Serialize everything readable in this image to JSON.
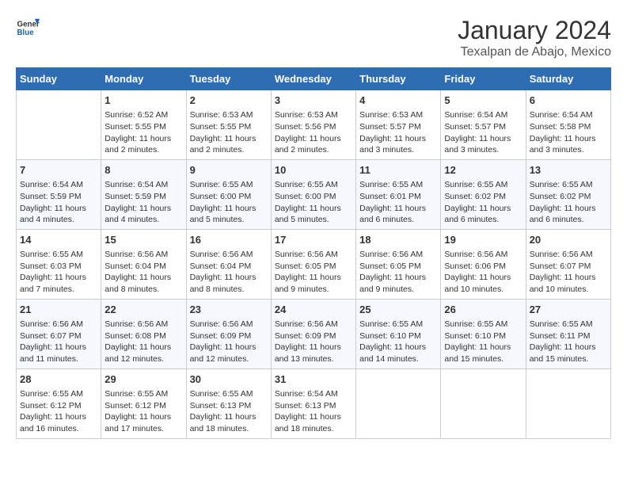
{
  "logo": {
    "line1": "General",
    "line2": "Blue"
  },
  "title": "January 2024",
  "location": "Texalpan de Abajo, Mexico",
  "days_of_week": [
    "Sunday",
    "Monday",
    "Tuesday",
    "Wednesday",
    "Thursday",
    "Friday",
    "Saturday"
  ],
  "weeks": [
    [
      {
        "day": "",
        "sunrise": "",
        "sunset": "",
        "daylight": ""
      },
      {
        "day": "1",
        "sunrise": "Sunrise: 6:52 AM",
        "sunset": "Sunset: 5:55 PM",
        "daylight": "Daylight: 11 hours and 2 minutes."
      },
      {
        "day": "2",
        "sunrise": "Sunrise: 6:53 AM",
        "sunset": "Sunset: 5:55 PM",
        "daylight": "Daylight: 11 hours and 2 minutes."
      },
      {
        "day": "3",
        "sunrise": "Sunrise: 6:53 AM",
        "sunset": "Sunset: 5:56 PM",
        "daylight": "Daylight: 11 hours and 2 minutes."
      },
      {
        "day": "4",
        "sunrise": "Sunrise: 6:53 AM",
        "sunset": "Sunset: 5:57 PM",
        "daylight": "Daylight: 11 hours and 3 minutes."
      },
      {
        "day": "5",
        "sunrise": "Sunrise: 6:54 AM",
        "sunset": "Sunset: 5:57 PM",
        "daylight": "Daylight: 11 hours and 3 minutes."
      },
      {
        "day": "6",
        "sunrise": "Sunrise: 6:54 AM",
        "sunset": "Sunset: 5:58 PM",
        "daylight": "Daylight: 11 hours and 3 minutes."
      }
    ],
    [
      {
        "day": "7",
        "sunrise": "Sunrise: 6:54 AM",
        "sunset": "Sunset: 5:59 PM",
        "daylight": "Daylight: 11 hours and 4 minutes."
      },
      {
        "day": "8",
        "sunrise": "Sunrise: 6:54 AM",
        "sunset": "Sunset: 5:59 PM",
        "daylight": "Daylight: 11 hours and 4 minutes."
      },
      {
        "day": "9",
        "sunrise": "Sunrise: 6:55 AM",
        "sunset": "Sunset: 6:00 PM",
        "daylight": "Daylight: 11 hours and 5 minutes."
      },
      {
        "day": "10",
        "sunrise": "Sunrise: 6:55 AM",
        "sunset": "Sunset: 6:00 PM",
        "daylight": "Daylight: 11 hours and 5 minutes."
      },
      {
        "day": "11",
        "sunrise": "Sunrise: 6:55 AM",
        "sunset": "Sunset: 6:01 PM",
        "daylight": "Daylight: 11 hours and 6 minutes."
      },
      {
        "day": "12",
        "sunrise": "Sunrise: 6:55 AM",
        "sunset": "Sunset: 6:02 PM",
        "daylight": "Daylight: 11 hours and 6 minutes."
      },
      {
        "day": "13",
        "sunrise": "Sunrise: 6:55 AM",
        "sunset": "Sunset: 6:02 PM",
        "daylight": "Daylight: 11 hours and 6 minutes."
      }
    ],
    [
      {
        "day": "14",
        "sunrise": "Sunrise: 6:55 AM",
        "sunset": "Sunset: 6:03 PM",
        "daylight": "Daylight: 11 hours and 7 minutes."
      },
      {
        "day": "15",
        "sunrise": "Sunrise: 6:56 AM",
        "sunset": "Sunset: 6:04 PM",
        "daylight": "Daylight: 11 hours and 8 minutes."
      },
      {
        "day": "16",
        "sunrise": "Sunrise: 6:56 AM",
        "sunset": "Sunset: 6:04 PM",
        "daylight": "Daylight: 11 hours and 8 minutes."
      },
      {
        "day": "17",
        "sunrise": "Sunrise: 6:56 AM",
        "sunset": "Sunset: 6:05 PM",
        "daylight": "Daylight: 11 hours and 9 minutes."
      },
      {
        "day": "18",
        "sunrise": "Sunrise: 6:56 AM",
        "sunset": "Sunset: 6:05 PM",
        "daylight": "Daylight: 11 hours and 9 minutes."
      },
      {
        "day": "19",
        "sunrise": "Sunrise: 6:56 AM",
        "sunset": "Sunset: 6:06 PM",
        "daylight": "Daylight: 11 hours and 10 minutes."
      },
      {
        "day": "20",
        "sunrise": "Sunrise: 6:56 AM",
        "sunset": "Sunset: 6:07 PM",
        "daylight": "Daylight: 11 hours and 10 minutes."
      }
    ],
    [
      {
        "day": "21",
        "sunrise": "Sunrise: 6:56 AM",
        "sunset": "Sunset: 6:07 PM",
        "daylight": "Daylight: 11 hours and 11 minutes."
      },
      {
        "day": "22",
        "sunrise": "Sunrise: 6:56 AM",
        "sunset": "Sunset: 6:08 PM",
        "daylight": "Daylight: 11 hours and 12 minutes."
      },
      {
        "day": "23",
        "sunrise": "Sunrise: 6:56 AM",
        "sunset": "Sunset: 6:09 PM",
        "daylight": "Daylight: 11 hours and 12 minutes."
      },
      {
        "day": "24",
        "sunrise": "Sunrise: 6:56 AM",
        "sunset": "Sunset: 6:09 PM",
        "daylight": "Daylight: 11 hours and 13 minutes."
      },
      {
        "day": "25",
        "sunrise": "Sunrise: 6:55 AM",
        "sunset": "Sunset: 6:10 PM",
        "daylight": "Daylight: 11 hours and 14 minutes."
      },
      {
        "day": "26",
        "sunrise": "Sunrise: 6:55 AM",
        "sunset": "Sunset: 6:10 PM",
        "daylight": "Daylight: 11 hours and 15 minutes."
      },
      {
        "day": "27",
        "sunrise": "Sunrise: 6:55 AM",
        "sunset": "Sunset: 6:11 PM",
        "daylight": "Daylight: 11 hours and 15 minutes."
      }
    ],
    [
      {
        "day": "28",
        "sunrise": "Sunrise: 6:55 AM",
        "sunset": "Sunset: 6:12 PM",
        "daylight": "Daylight: 11 hours and 16 minutes."
      },
      {
        "day": "29",
        "sunrise": "Sunrise: 6:55 AM",
        "sunset": "Sunset: 6:12 PM",
        "daylight": "Daylight: 11 hours and 17 minutes."
      },
      {
        "day": "30",
        "sunrise": "Sunrise: 6:55 AM",
        "sunset": "Sunset: 6:13 PM",
        "daylight": "Daylight: 11 hours and 18 minutes."
      },
      {
        "day": "31",
        "sunrise": "Sunrise: 6:54 AM",
        "sunset": "Sunset: 6:13 PM",
        "daylight": "Daylight: 11 hours and 18 minutes."
      },
      {
        "day": "",
        "sunrise": "",
        "sunset": "",
        "daylight": ""
      },
      {
        "day": "",
        "sunrise": "",
        "sunset": "",
        "daylight": ""
      },
      {
        "day": "",
        "sunrise": "",
        "sunset": "",
        "daylight": ""
      }
    ]
  ]
}
